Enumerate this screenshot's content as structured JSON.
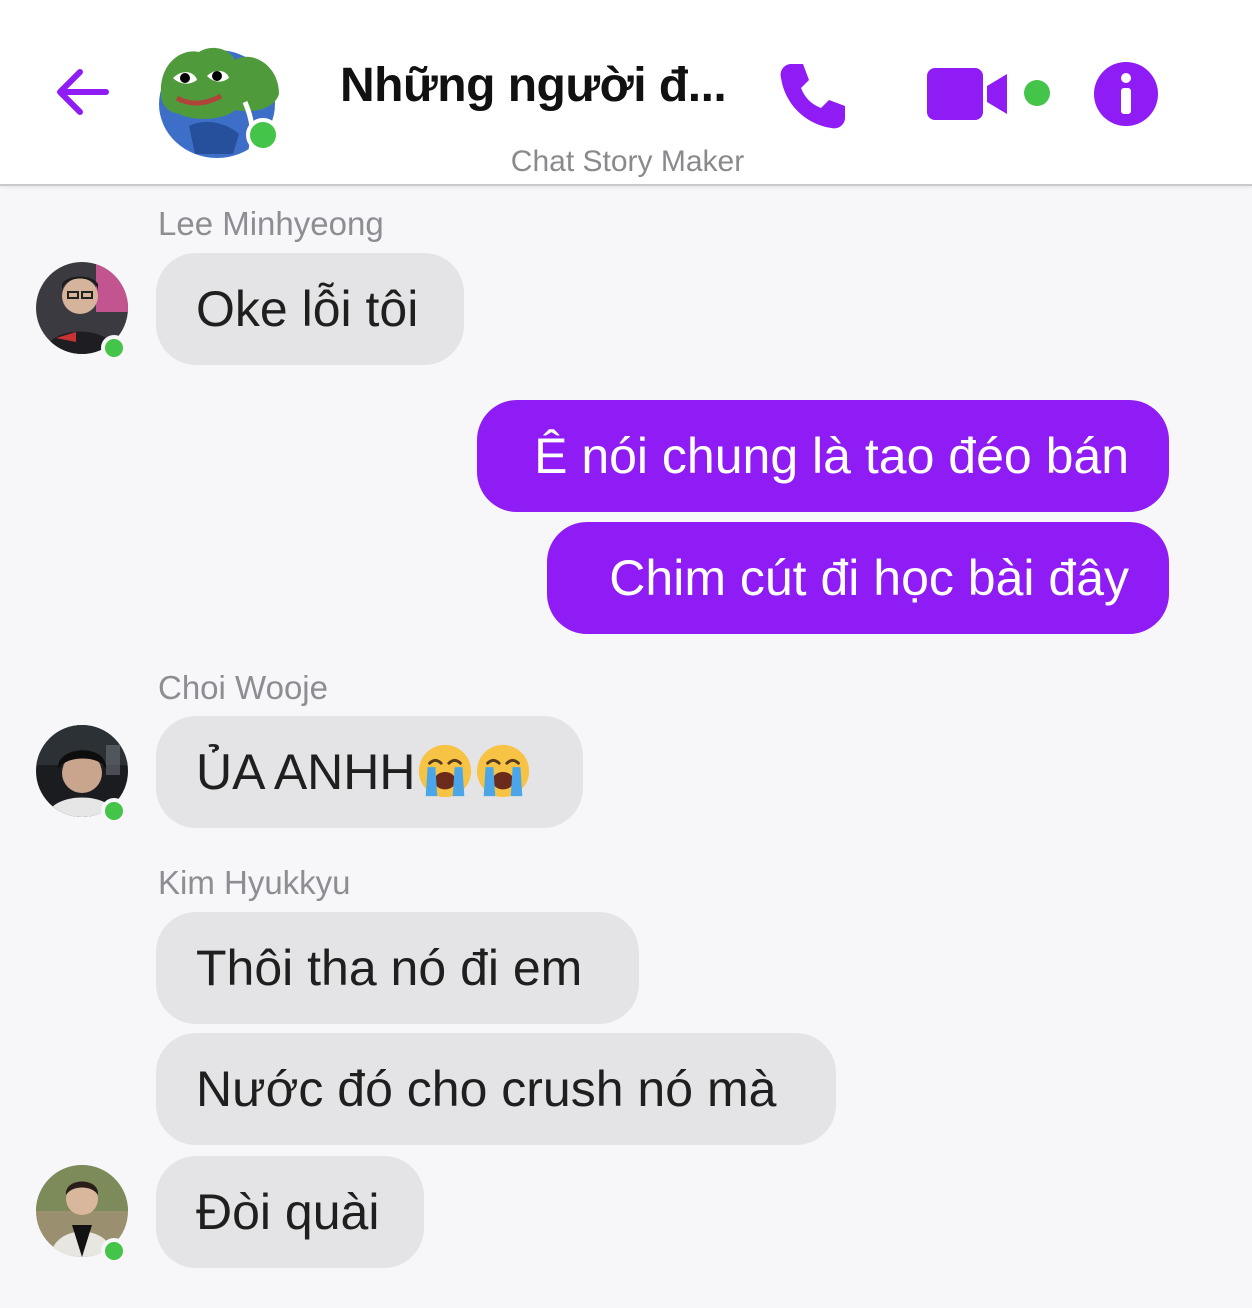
{
  "header": {
    "title": "Những người đ...",
    "subtitle": "Chat Story Maker",
    "accent_color": "#8f1bf5",
    "online_color": "#45c44a",
    "back_icon": "arrow-left-icon",
    "call_icon": "phone-icon",
    "video_icon": "video-camera-icon",
    "info_icon": "info-icon"
  },
  "messages": [
    {
      "sender": "Lee Minhyeong",
      "text": "Oke lỗi tôi"
    },
    {
      "text": "Ê nói chung là tao đéo bán"
    },
    {
      "text": "Chim cút đi học bài đây"
    },
    {
      "sender": "Choi Wooje",
      "text": "ỦA ANHH"
    },
    {
      "sender": "Kim Hyukkyu",
      "text": "Thôi tha nó đi em"
    },
    {
      "text": "Nước đó cho crush nó mà"
    },
    {
      "text": "Đòi quài"
    }
  ],
  "emoji": "crying-face-icon"
}
